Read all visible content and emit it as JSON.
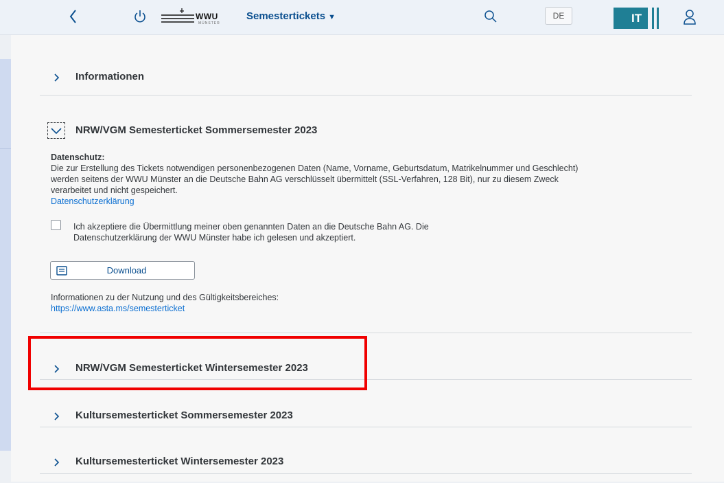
{
  "header": {
    "logo_text": "WWU",
    "logo_subtext": "MÜNSTER",
    "app_title": "Semestertickets",
    "language": "DE",
    "it_logo_text": "IT"
  },
  "sections": {
    "informationen": {
      "title": "Informationen"
    },
    "sommer_ticket": {
      "title": "NRW/VGM Semesterticket Sommersemester 2023",
      "privacy_heading": "Datenschutz:",
      "privacy_line1": "Die zur Erstellung des Tickets notwendigen personenbezogenen Daten (Name, Vorname, Geburtsdatum, Matrikelnummer und Geschlecht)",
      "privacy_line2": "werden seitens der WWU Münster an die Deutsche Bahn AG verschlüsselt übermittelt (SSL-Verfahren, 128 Bit), nur zu diesem Zweck",
      "privacy_line3": "verarbeitet und nicht gespeichert.",
      "privacy_link": "Datenschutzerklärung",
      "consent_line1": "Ich akzeptiere die Übermittlung meiner oben genannten Daten an die Deutsche Bahn AG. Die",
      "consent_line2": "Datenschutzerklärung der WWU Münster habe ich gelesen und akzeptiert.",
      "download_label": "Download",
      "info_text": "Informationen zu der Nutzung und des Gültigkeitsbereiches:",
      "info_link": "https://www.asta.ms/semesterticket"
    },
    "winter_ticket": {
      "title": "NRW/VGM Semesterticket Wintersemester 2023"
    },
    "kultur_sommer": {
      "title": "Kultursemesterticket Sommersemester 2023"
    },
    "kultur_winter": {
      "title": "Kultursemesterticket Wintersemester 2023"
    }
  },
  "colors": {
    "accent": "#0a6ed1",
    "highlight": "#f00000",
    "it_logo": "#1f7f95"
  }
}
